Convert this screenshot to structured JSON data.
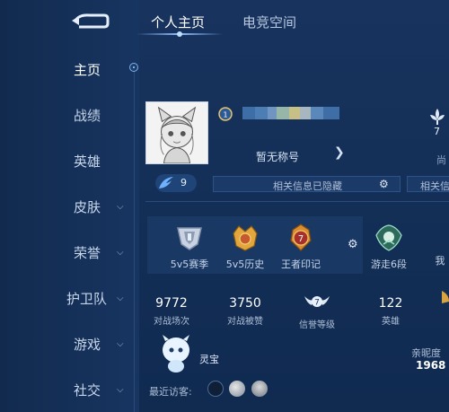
{
  "header": {
    "tabs": [
      {
        "label": "个人主页",
        "active": true
      },
      {
        "label": "电竞空间",
        "active": false
      }
    ]
  },
  "sidebar": {
    "items": [
      {
        "label": "主页",
        "active": true,
        "has_chevron": false
      },
      {
        "label": "战绩",
        "active": false,
        "has_chevron": false
      },
      {
        "label": "英雄",
        "active": false,
        "has_chevron": false
      },
      {
        "label": "皮肤",
        "active": false,
        "has_chevron": true
      },
      {
        "label": "荣誉",
        "active": false,
        "has_chevron": true
      },
      {
        "label": "护卫队",
        "active": false,
        "has_chevron": true
      },
      {
        "label": "游戏",
        "active": false,
        "has_chevron": true
      },
      {
        "label": "社交",
        "active": false,
        "has_chevron": true
      }
    ]
  },
  "profile": {
    "avatar_icon": "anime-cat-girl-avatar",
    "title": "暂无称号",
    "level_badge": "9",
    "info_hidden": "相关信息已隐藏",
    "info_hidden_2": "相关信",
    "right_count": "7",
    "right_fragment": "尚"
  },
  "honors": [
    {
      "label": "5v5赛季",
      "icon": "silver-rank-icon"
    },
    {
      "label": "5v5历史",
      "icon": "gold-crown-rank-icon"
    },
    {
      "label": "王者印记",
      "icon": "king-mark-icon",
      "badge": "7"
    },
    {
      "label": "游走6段",
      "icon": "roam-rank-icon"
    },
    {
      "label": "我",
      "icon": "partial-icon"
    }
  ],
  "stats": [
    {
      "value": "9772",
      "label": "对战场次"
    },
    {
      "value": "3750",
      "label": "对战被赞"
    },
    {
      "value": "",
      "label": "信誉等级",
      "badge": "7"
    },
    {
      "value": "122",
      "label": "英雄"
    }
  ],
  "pet": {
    "name": "灵宝"
  },
  "visitors": {
    "label": "最近访客:"
  },
  "intimacy": {
    "label": "亲昵度",
    "value": "1968"
  },
  "colors": {
    "background": "#143058",
    "accent": "#8fc0ff",
    "panel": "#1a3864"
  }
}
